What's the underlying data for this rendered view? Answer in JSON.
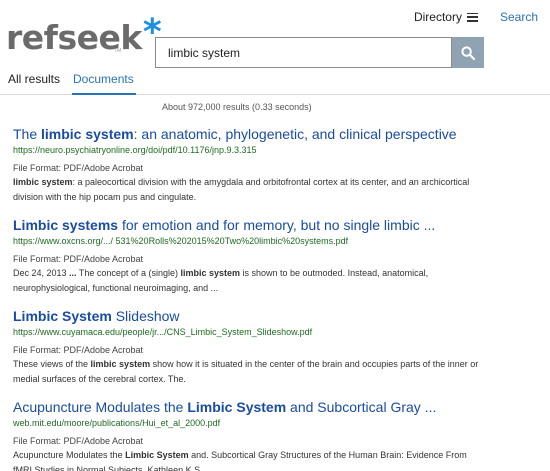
{
  "header": {
    "logo_text": "refseek",
    "logo_star": "*",
    "logo_tm": "TM",
    "directory_label": "Directory",
    "search_link_label": "Search"
  },
  "search": {
    "query": "limbic system"
  },
  "tabs": [
    {
      "label": "All results",
      "active": false
    },
    {
      "label": "Documents",
      "active": true
    }
  ],
  "results_count": "About 972,000 results (0.33 seconds)",
  "colors": {
    "link": "#1a4ca3",
    "url": "#1e6b21",
    "accent": "#2a73b8",
    "search_button": "#8fa3b3",
    "logo_star": "#1a8fe3"
  },
  "results": [
    {
      "title": [
        {
          "t": "The ",
          "b": false
        },
        {
          "t": "limbic system",
          "b": true
        },
        {
          "t": ": an anatomic, phylogenetic, and clinical perspective",
          "b": false
        }
      ],
      "url": "https://neuro.psychiatryonline.org/doi/pdf/10.1176/jnp.9.3.315",
      "format": "File Format: PDF/Adobe Acrobat",
      "snippet": [
        {
          "t": "limbic system",
          "b": true
        },
        {
          "t": ": a paleocortical division with the amygdala and orbitofrontal cortex at its center, and an archicortical division with the hip pocam pus and cingulate.",
          "b": false
        }
      ]
    },
    {
      "title": [
        {
          "t": "Limbic systems",
          "b": true
        },
        {
          "t": " for emotion and for memory, but no single limbic ...",
          "b": false
        }
      ],
      "url": "https://www.oxcns.org/.../ 531%20Rolls%202015%20Two%20limbic%20systems.pdf",
      "format": "File Format: PDF/Adobe Acrobat",
      "snippet": [
        {
          "t": "Dec 24, 2013 ",
          "b": false
        },
        {
          "t": "...",
          "b": true
        },
        {
          "t": " The concept of a (single) ",
          "b": false
        },
        {
          "t": "limbic system",
          "b": true
        },
        {
          "t": " is shown to be outmoded. Instead, anatomical, neurophysiological, functional neuroimaging, and ...",
          "b": false
        }
      ]
    },
    {
      "title": [
        {
          "t": "Limbic System",
          "b": true
        },
        {
          "t": " Slideshow",
          "b": false
        }
      ],
      "url": "https://www.cuyamaca.edu/people/jr.../CNS_Limbic_System_Slideshow.pdf",
      "format": "File Format: PDF/Adobe Acrobat",
      "snippet": [
        {
          "t": "These views of the ",
          "b": false
        },
        {
          "t": "limbic system",
          "b": true
        },
        {
          "t": " show how it is situated in the center of the brain and occupies parts of the inner or medial surfaces of the cerebral cortex. The.",
          "b": false
        }
      ]
    },
    {
      "title": [
        {
          "t": "Acupuncture Modulates the ",
          "b": false
        },
        {
          "t": "Limbic System",
          "b": true
        },
        {
          "t": " and Subcortical Gray ...",
          "b": false
        }
      ],
      "url": "web.mit.edu/moore/publications/Hui_et_al_2000.pdf",
      "format": "File Format: PDF/Adobe Acrobat",
      "snippet": [
        {
          "t": "Acupuncture Modulates the ",
          "b": false
        },
        {
          "t": "Limbic System",
          "b": true
        },
        {
          "t": " and. Subcortical Gray Structures of the Human Brain: Evidence From fMRI Studies in Normal Subjects. Kathleen K.S.  ...",
          "b": false
        }
      ]
    }
  ]
}
